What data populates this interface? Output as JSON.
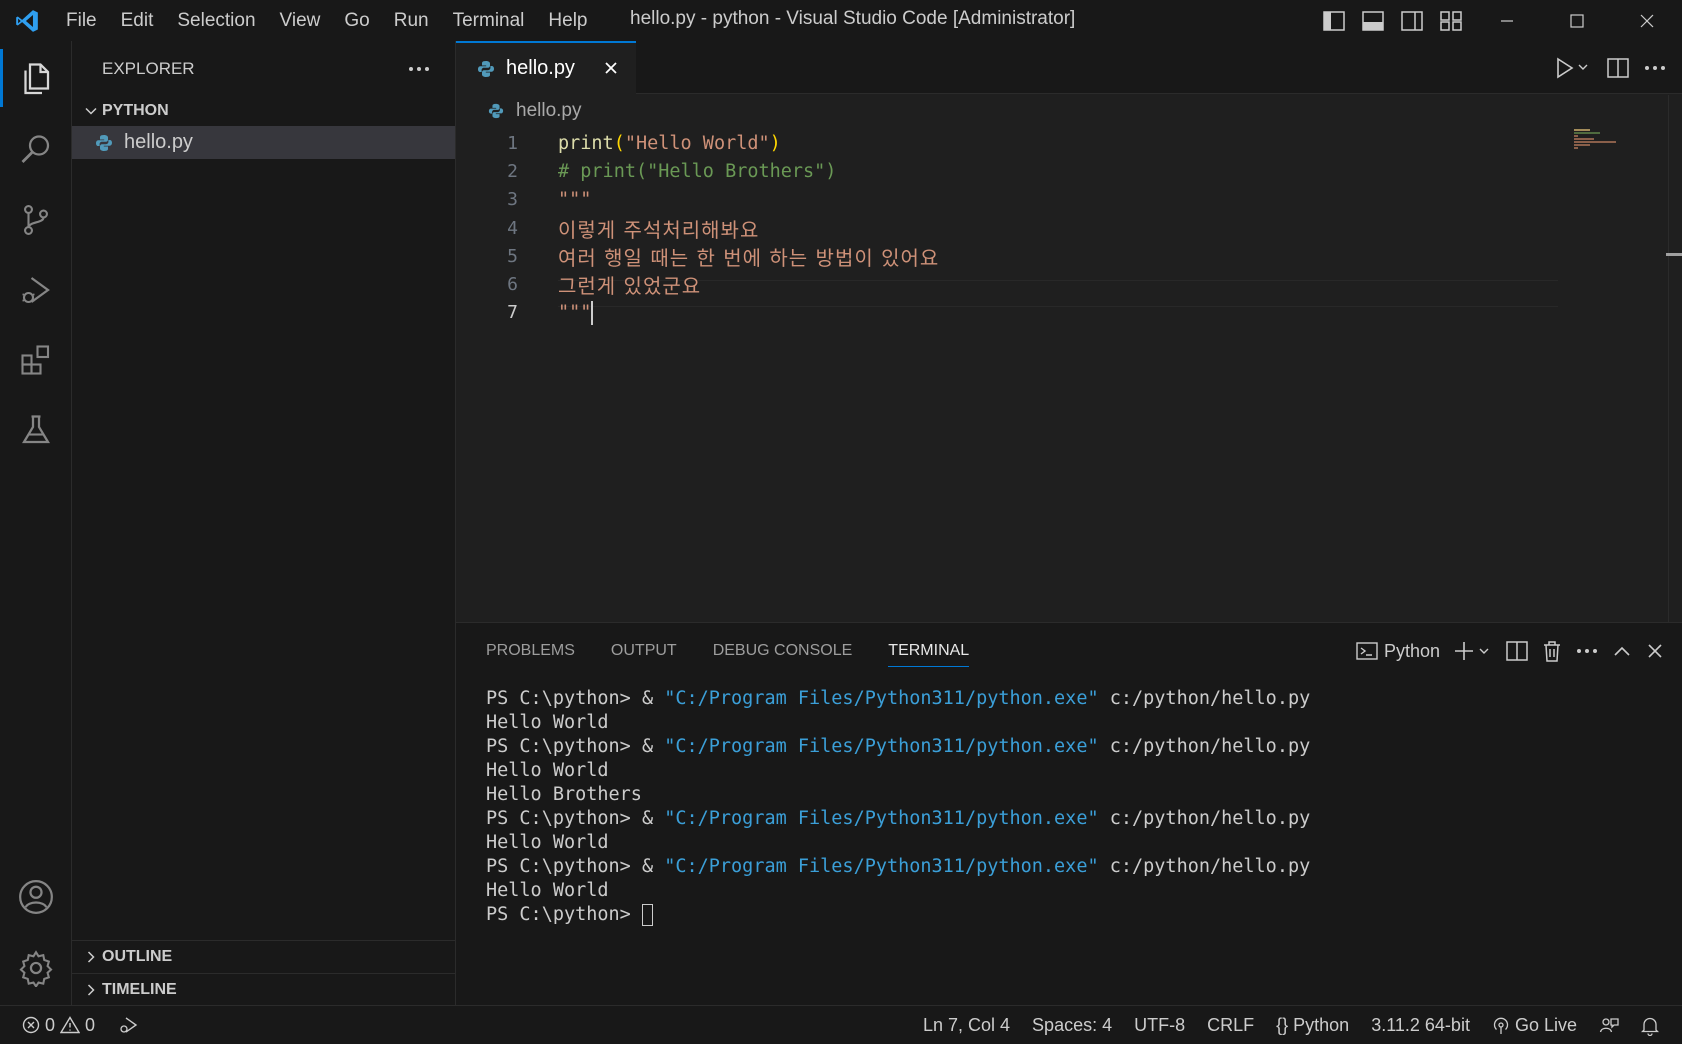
{
  "titlebar": {
    "menu": [
      "File",
      "Edit",
      "Selection",
      "View",
      "Go",
      "Run",
      "Terminal",
      "Help"
    ],
    "window_title": "hello.py - python - Visual Studio Code [Administrator]"
  },
  "sidebar": {
    "title": "EXPLORER",
    "folder": "PYTHON",
    "files": [
      "hello.py"
    ],
    "sections": [
      "OUTLINE",
      "TIMELINE"
    ]
  },
  "editor": {
    "tab_label": "hello.py",
    "breadcrumb": "hello.py",
    "line_numbers": [
      "1",
      "2",
      "3",
      "4",
      "5",
      "6",
      "7"
    ],
    "lines": {
      "l1_fn": "print",
      "l1_open": "(",
      "l1_str": "\"Hello World\"",
      "l1_close": ")",
      "l2": "# print(\"Hello Brothers\")",
      "l3": "\"\"\"",
      "l4": "이렇게 주석처리해봐요",
      "l5": "여러 행일 때는 한 번에 하는 방법이 있어요",
      "l6": "그런게 있었군요",
      "l7": "\"\"\""
    }
  },
  "panel": {
    "tabs": [
      "PROBLEMS",
      "OUTPUT",
      "DEBUG CONSOLE",
      "TERMINAL"
    ],
    "active_tab": "TERMINAL",
    "terminal_profile": "Python",
    "terminal": {
      "prompt": "PS C:\\python> ",
      "amp": "& ",
      "exe": "\"C:/Program Files/Python311/python.exe\"",
      "script": " c:/python/hello.py",
      "out_hello_world": "Hello World",
      "out_hello_brothers": "Hello Brothers",
      "final_prompt": "PS C:\\python> "
    }
  },
  "statusbar": {
    "errors": "0",
    "warnings": "0",
    "position": "Ln 7, Col 4",
    "spaces": "Spaces: 4",
    "encoding": "UTF-8",
    "eol": "CRLF",
    "language": "Python",
    "interpreter": "3.11.2 64-bit",
    "go_live": "Go Live"
  },
  "colors": {
    "accent": "#0078d4",
    "string": "#ce9178",
    "comment": "#6a9955",
    "function": "#dcdcaa",
    "terminal_string": "#3b9fd8"
  }
}
